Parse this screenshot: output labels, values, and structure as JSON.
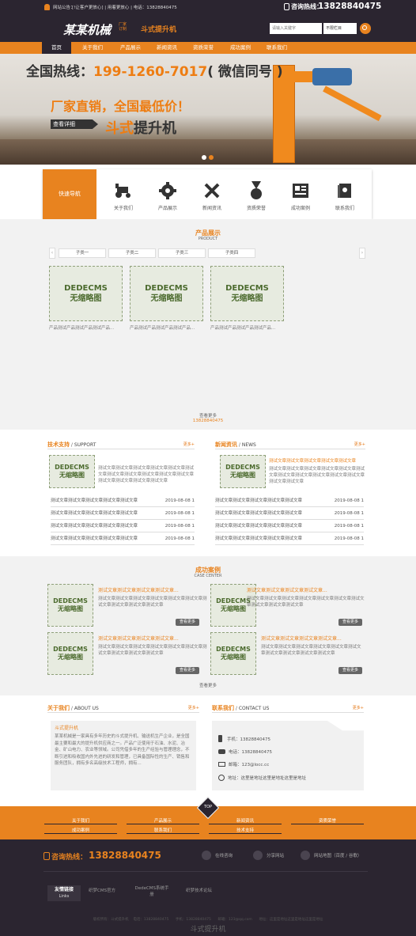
{
  "topbar": {
    "notice_label": "网站公告：",
    "notice_text": "[!让客户更放心] | 用着更放心 | 电话：13828840475",
    "hotline_label": "咨询热线：",
    "hotline_number": "13828840475"
  },
  "header": {
    "logo_main": "某某机械",
    "logo_badge_top": "厂家",
    "logo_badge_bottom": "订制",
    "logo_sub": "斗式提升机",
    "search_placeholder": "请输入关键字",
    "select_value": "不限栏目"
  },
  "nav": [
    "首页",
    "关于我们",
    "产品展示",
    "新闻资讯",
    "资质荣誉",
    "成功案例",
    "联系我们"
  ],
  "banner": {
    "hotline_prefix": "全国热线：",
    "hotline": "199-1260-7017",
    "hotline_suffix": "( 微信同号 )",
    "slogan": "厂家直销，全国最低价！",
    "view_btn": "查看详细",
    "product_a": "斗式",
    "product_b": "提升机"
  },
  "quicknav": {
    "label": "快速导航",
    "items": [
      "关于我们",
      "产品展示",
      "新闻资讯",
      "资质荣誉",
      "成功案例",
      "联系我们"
    ]
  },
  "products": {
    "title": "产品展示",
    "subtitle": "PRODUCT",
    "tabs": [
      "子类一",
      "子类二",
      "子类三",
      "子类四"
    ],
    "placeholder_line1": "DEDECMS",
    "placeholder_line2": "无缩略图",
    "captions": [
      "产品测试产品测试产品测试产品...",
      "产品测试产品测试产品测试产品...",
      "产品测试产品测试产品测试产品..."
    ],
    "more": "查看更多",
    "more_phone": "13828840475"
  },
  "tech": {
    "title": "技术支持",
    "title_en": "SUPPORT",
    "more": "更多+",
    "summary": "测试文章测试文章测试文章测试文章测试文章测试文章测试文章测试文章测试文章测试文章测试文章测试文章测试文章测试文章测试文章",
    "rows": [
      {
        "t": "测试文章测试文章测试文章测试文章测试文章",
        "d": "2019-08-08 1"
      },
      {
        "t": "测试文章测试文章测试文章测试文章测试文章",
        "d": "2019-08-08 1"
      },
      {
        "t": "测试文章测试文章测试文章测试文章测试文章",
        "d": "2019-08-08 1"
      },
      {
        "t": "测试文章测试文章测试文章测试文章测试文章",
        "d": "2019-08-08 1"
      }
    ]
  },
  "news": {
    "title": "新闻资讯",
    "title_en": "NEWS",
    "more": "更多+",
    "headline": "测试文章测试文章测试文章测试文章测试文章",
    "summary": "测试文章测试文章测试文章测试文章测试文章测试文章测试文章测试文章测试文章测试文章测试文章测试文章测试文章",
    "rows": [
      {
        "t": "测试文章测试文章测试文章测试文章测试文章",
        "d": "2019-08-08 1"
      },
      {
        "t": "测试文章测试文章测试文章测试文章测试文章",
        "d": "2019-08-08 1"
      },
      {
        "t": "测试文章测试文章测试文章测试文章测试文章",
        "d": "2019-08-08 1"
      },
      {
        "t": "测试文章测试文章测试文章测试文章测试文章",
        "d": "2019-08-08 1"
      }
    ]
  },
  "cases": {
    "title": "成功案例",
    "subtitle": "CASE CENTER",
    "item_title": "测试文章测试文章测试文章测试文章...",
    "item_text": "测试文章测试文章测试文章测试文章测试文章测试文章测试文章测试文章测试文章测试文章",
    "view": "查看更多",
    "more": "查看更多"
  },
  "about": {
    "title": "关于我们",
    "title_en": "ABOUT US",
    "more": "更多+",
    "heading": "斗式提升机",
    "text": "某某机械是一家具有多年历史的斗式提升机、输送机生产企业，是全国最主要和最大的提升机供应商之一。产品广泛使用于石油、水泥、冶金、矿山电力、农业等领域。公司凭借多年的生产经验与管理理念，不断引进和吸收国内外先进的研发和管理，已具备国际性的生产、销售和服务团队，拥有多名高级技术工程师，拥有..."
  },
  "contact": {
    "title": "联系我们",
    "title_en": "CONTACT US",
    "more": "更多+",
    "mobile": "手机：13828840475",
    "phone": "电话：13828840475",
    "email": "邮箱：123@locc.cc",
    "address": "地址：这里是地址这里是地址这里是地址"
  },
  "footer": {
    "top": "TOP",
    "links": [
      "关于我们",
      "产品展示",
      "新闻资讯",
      "资质荣誉",
      "成功案例",
      "联系我们",
      "技术支持"
    ],
    "hotline_label": "咨询热线：",
    "hotline": "13828840475",
    "tools": [
      "在线咨询",
      "分享网站",
      "网站地图（百度 / 谷歌）"
    ],
    "friend_label": "友情链接",
    "friend_en": "Links",
    "friends": [
      "织梦CMS官方",
      "DedeCMS系统手册",
      "织梦技术论坛"
    ],
    "copyright": "版权所有：斗式提升机    电话：13828840475      手机：13828840475      邮箱：123@qq.com      地址：这里是地址这里是地址这里是地址",
    "brand": "斗式提升机"
  },
  "colors": {
    "orange": "#e8831f",
    "dark": "#2b2530"
  }
}
